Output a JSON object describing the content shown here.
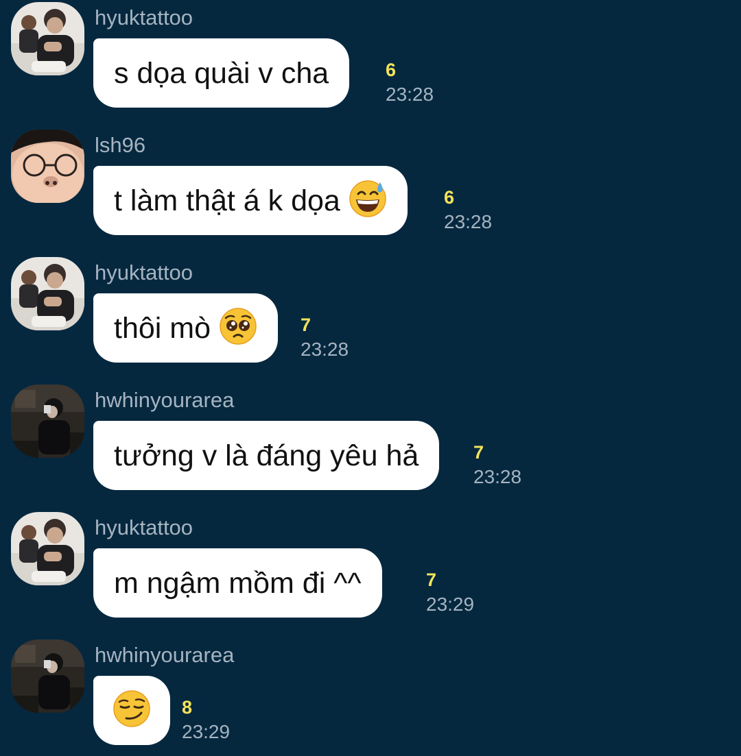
{
  "colors": {
    "background": "#05283f",
    "bubble": "#ffffff",
    "sender_text": "#a6b4c0",
    "count_text": "#f4e35a"
  },
  "messages": [
    {
      "sender": "hyuktattoo",
      "text": "s dọa quài v cha",
      "emoji": "",
      "count": "6",
      "time": "23:28",
      "avatar": "avatar-hyuktattoo"
    },
    {
      "sender": "lsh96",
      "text": "t làm thật á k dọa",
      "emoji": "grinning-sweat-emoji",
      "count": "6",
      "time": "23:28",
      "avatar": "avatar-lsh96"
    },
    {
      "sender": "hyuktattoo",
      "text": "thôi mò",
      "emoji": "pleading-face-emoji",
      "count": "7",
      "time": "23:28",
      "avatar": "avatar-hyuktattoo"
    },
    {
      "sender": "hwhinyourarea",
      "text": "tưởng v là đáng yêu hả",
      "emoji": "",
      "count": "7",
      "time": "23:28",
      "avatar": "avatar-hwhinyourarea"
    },
    {
      "sender": "hyuktattoo",
      "text": "m ngậm mồm đi ^^",
      "emoji": "",
      "count": "7",
      "time": "23:29",
      "avatar": "avatar-hyuktattoo"
    },
    {
      "sender": "hwhinyourarea",
      "text": "",
      "emoji": "smirking-face-emoji",
      "count": "8",
      "time": "23:29",
      "avatar": "avatar-hwhinyourarea"
    }
  ]
}
